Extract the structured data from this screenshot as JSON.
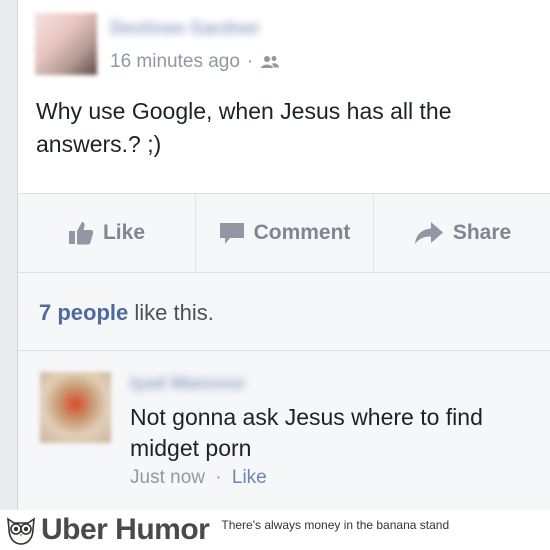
{
  "post": {
    "author": "Destinee Gardner",
    "timestamp": "16 minutes ago",
    "separator": "·",
    "privacy_icon": "friends-icon",
    "text": "Why use Google, when Jesus has all the answers.? ;)"
  },
  "actions": {
    "like_label": "Like",
    "comment_label": "Comment",
    "share_label": "Share"
  },
  "likes": {
    "count": "7 people",
    "suffix": "like this."
  },
  "comment": {
    "author": "Iyad Mansour",
    "text": "Not gonna ask Jesus where to find midget porn",
    "timestamp": "Just now",
    "separator": "·",
    "like_label": "Like"
  },
  "footer": {
    "brand": "Uber Humor",
    "tagline": "There's always money in the banana stand"
  },
  "colors": {
    "link": "#3b5998",
    "text": "#1d2129",
    "muted": "#9197a3",
    "action_gray": "#7f8591"
  }
}
